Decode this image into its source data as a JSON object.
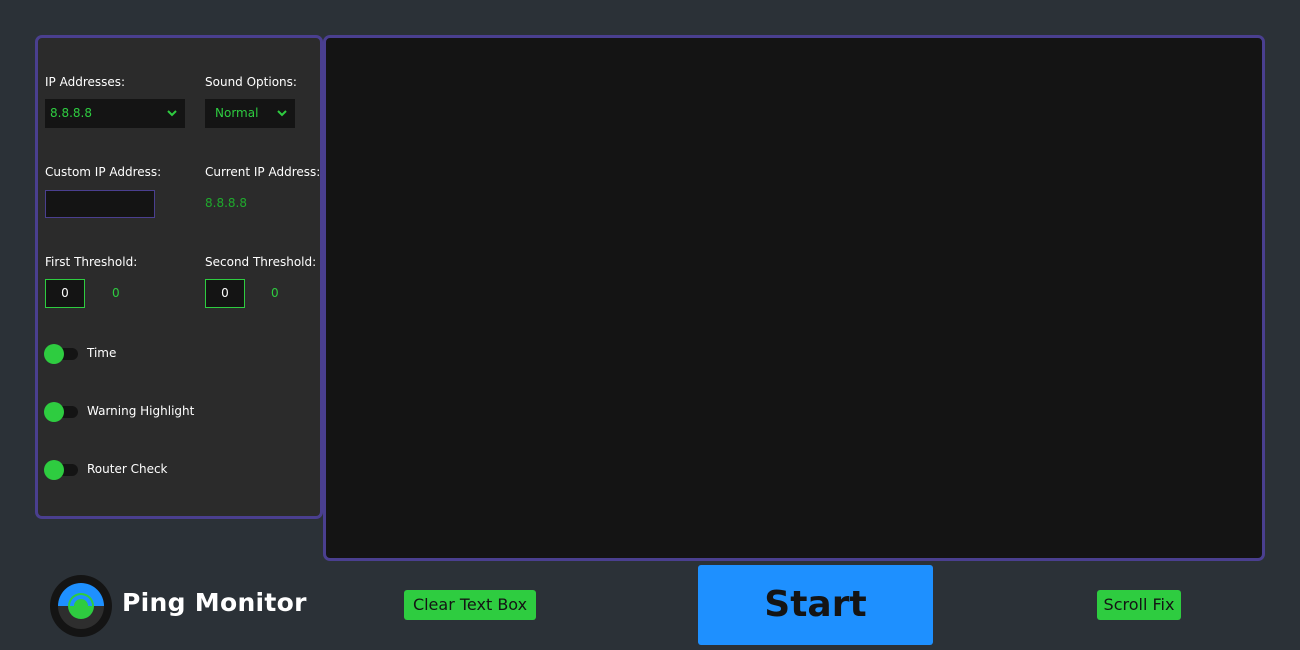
{
  "settings": {
    "ip_addresses_label": "IP Addresses:",
    "ip_addresses_value": "8.8.8.8",
    "sound_options_label": "Sound Options:",
    "sound_options_value": "Normal",
    "custom_ip_label": "Custom IP Address:",
    "custom_ip_value": "",
    "current_ip_label": "Current IP Address:",
    "current_ip_value": "8.8.8.8",
    "first_threshold_label": "First Threshold:",
    "first_threshold_input": "0",
    "first_threshold_value": "0",
    "second_threshold_label": "Second Threshold:",
    "second_threshold_input": "0",
    "second_threshold_value": "0"
  },
  "toggles": [
    {
      "label": "Time",
      "on": true
    },
    {
      "label": "Warning Highlight",
      "on": true
    },
    {
      "label": "Router Check",
      "on": true
    }
  ],
  "app": {
    "title": "Ping Monitor"
  },
  "buttons": {
    "clear_label": "Clear Text Box",
    "start_label": "Start",
    "scroll_fix_label": "Scroll Fix"
  },
  "colors": {
    "accent_green": "#2ecc40",
    "accent_blue": "#1e90ff",
    "panel_border": "#4a3f8f",
    "background": "#2b3137"
  },
  "icons": {
    "dropdown": "chevron-down-icon",
    "logo": "ping-monitor-logo-icon"
  }
}
